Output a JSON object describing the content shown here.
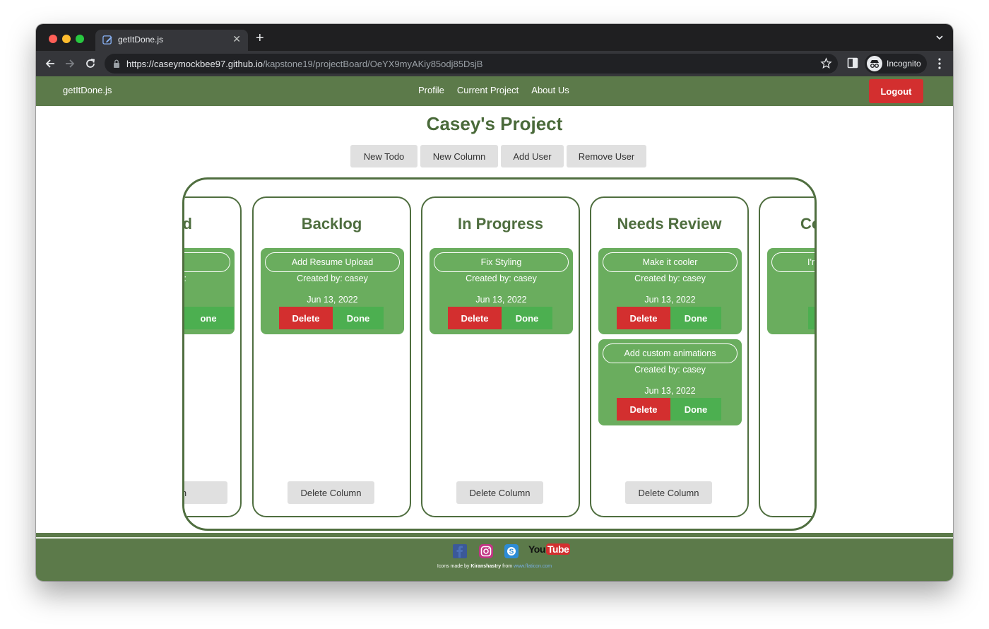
{
  "browser": {
    "tab_title": "getItDone.js",
    "url_domain": "https://caseymockbee97.github.io",
    "url_path": "/kapstone19/projectBoard/OeYX9myAKiy85odj85DsjB",
    "profile_label": "Incognito"
  },
  "nav": {
    "brand": "getItDone.js",
    "links": [
      "Profile",
      "Current Project",
      "About Us"
    ],
    "logout_label": "Logout"
  },
  "project": {
    "title": "Casey's Project",
    "actions": [
      "New Todo",
      "New Column",
      "Add User",
      "Remove User"
    ]
  },
  "columns": [
    {
      "title": "d",
      "cards": [
        {
          "title": "",
          "creator": ":",
          "date": "",
          "delete_label": "",
          "done_label": "one"
        }
      ],
      "delete_label": "n"
    },
    {
      "title": "Backlog",
      "cards": [
        {
          "title": "Add Resume Upload",
          "creator": "Created by: casey",
          "date": "Jun 13, 2022",
          "delete_label": "Delete",
          "done_label": "Done"
        }
      ],
      "delete_label": "Delete Column"
    },
    {
      "title": "In Progress",
      "cards": [
        {
          "title": "Fix Styling",
          "creator": "Created by: casey",
          "date": "Jun 13, 2022",
          "delete_label": "Delete",
          "done_label": "Done"
        }
      ],
      "delete_label": "Delete Column"
    },
    {
      "title": "Needs Review",
      "cards": [
        {
          "title": "Make it cooler",
          "creator": "Created by: casey",
          "date": "Jun 13, 2022",
          "delete_label": "Delete",
          "done_label": "Done"
        },
        {
          "title": "Add custom animations",
          "creator": "Created by: casey",
          "date": "Jun 13, 2022",
          "delete_label": "Delete",
          "done_label": "Done"
        }
      ],
      "delete_label": "Delete Column"
    },
    {
      "title": "Co",
      "cards": [
        {
          "title": "I'r",
          "creator": "",
          "date": "",
          "delete_label": "",
          "done_label": ""
        }
      ],
      "delete_label": ""
    }
  ],
  "footer": {
    "social": [
      "facebook-icon",
      "instagram-icon",
      "skype-icon",
      "youtube-icon"
    ],
    "youtube_you": "You",
    "youtube_tube": "Tube",
    "credit_prefix": "Icons made by",
    "credit_author": "Kiranshastry",
    "credit_from": "from",
    "credit_source": "www.flaticon.com"
  },
  "colors": {
    "nav_green": "#5c7a4a",
    "title_green": "#4a6a3a",
    "card_green": "#6aad5e",
    "delete_red": "#d32f2f",
    "done_green": "#4caf50"
  }
}
